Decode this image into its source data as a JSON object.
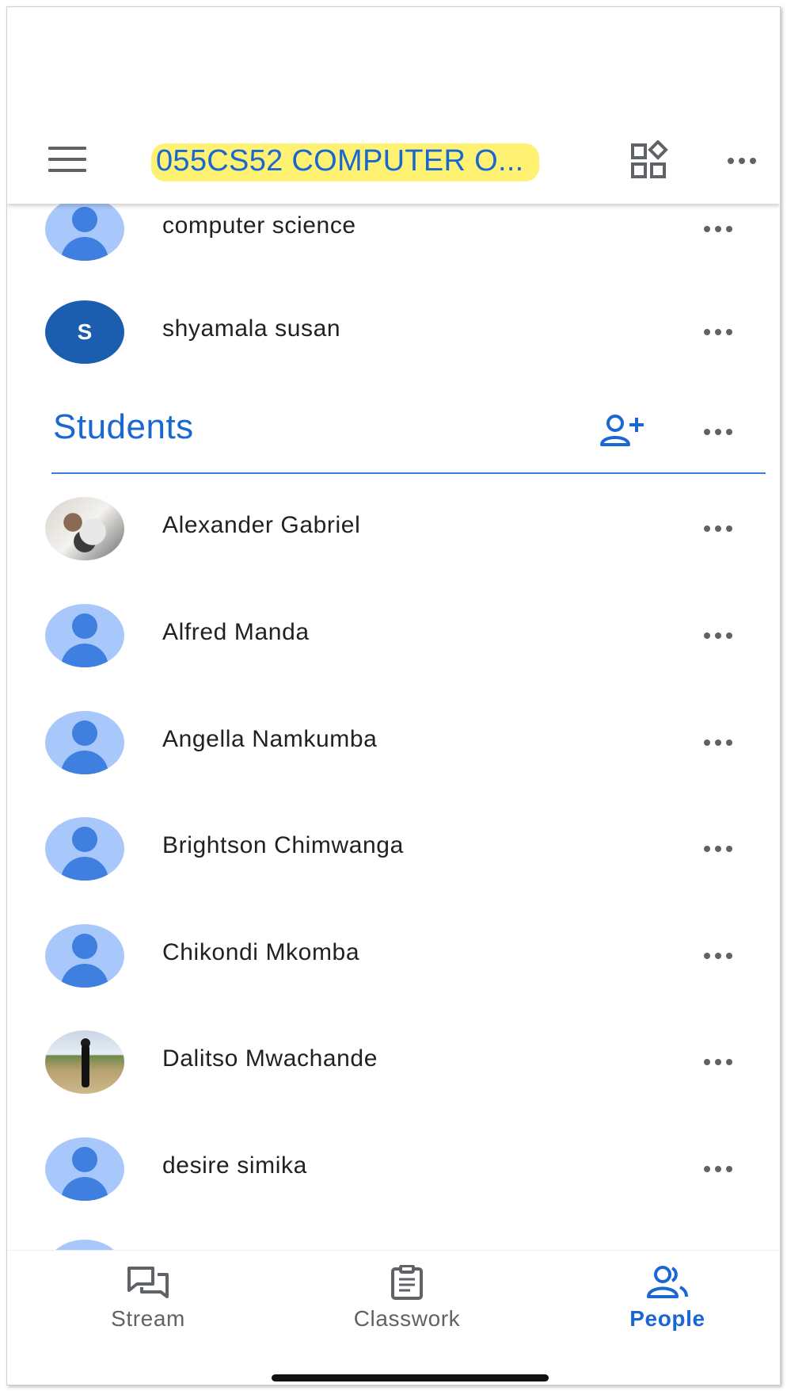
{
  "appbar": {
    "class_title": "055CS52 COMPUTER O..."
  },
  "teachers": [
    {
      "name": "computer science",
      "avatar": "generic-avatar"
    },
    {
      "name": "shyamala susan",
      "avatar": "letter-avatar",
      "initial": "S"
    }
  ],
  "students_section": {
    "title": "Students"
  },
  "students": [
    {
      "name": "Alexander Gabriel",
      "avatar": "photo-avatar"
    },
    {
      "name": "Alfred Manda",
      "avatar": "generic-avatar"
    },
    {
      "name": "Angella Namkumba",
      "avatar": "generic-avatar"
    },
    {
      "name": "Brightson Chimwanga",
      "avatar": "generic-avatar"
    },
    {
      "name": "Chikondi Mkomba",
      "avatar": "generic-avatar"
    },
    {
      "name": "Dalitso Mwachande",
      "avatar": "photo-avatar"
    },
    {
      "name": "desire simika",
      "avatar": "generic-avatar"
    }
  ],
  "bottom_nav": {
    "stream": "Stream",
    "classwork": "Classwork",
    "people": "People",
    "active": "People"
  },
  "colors": {
    "accent": "#1967d2",
    "highlight": "#fff06a",
    "avatar_light": "#a8c7fa",
    "avatar_dark": "#3f7fe0",
    "letter_avatar": "#1b5eb0"
  }
}
